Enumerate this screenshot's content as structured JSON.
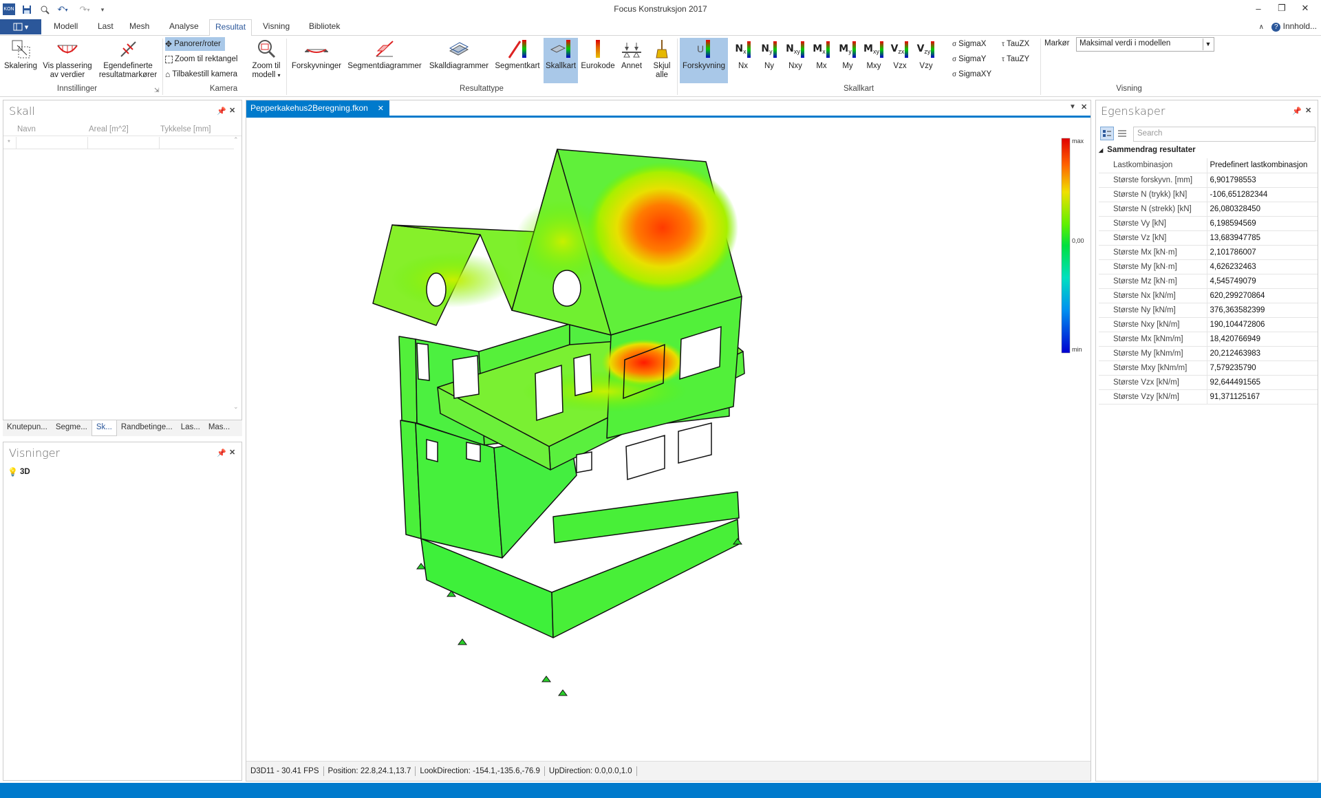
{
  "app": {
    "title": "Focus Konstruksjon 2017",
    "help_label": "Innhold..."
  },
  "ribbon_tabs": [
    {
      "label": "Modell",
      "active": false
    },
    {
      "label": "Last",
      "active": false
    },
    {
      "label": "Mesh",
      "active": false
    },
    {
      "label": "Analyse",
      "active": false
    },
    {
      "label": "Resultat",
      "active": true
    },
    {
      "label": "Visning",
      "active": false
    },
    {
      "label": "Bibliotek",
      "active": false
    }
  ],
  "ribbon": {
    "innstillinger": {
      "group_label": "Innstillinger",
      "skalering": "Skalering",
      "vis_plassering_1": "Vis plassering",
      "vis_plassering_2": "av verdier",
      "egendefinerte_1": "Egendefinerte",
      "egendefinerte_2": "resultatmarkører"
    },
    "kamera": {
      "group_label": "Kamera",
      "panorer": "Panorer/roter",
      "zoom_rektangel": "Zoom til rektangel",
      "tilbakestill": "Tilbakestill kamera",
      "zoom_modell_1": "Zoom til",
      "zoom_modell_2": "modell"
    },
    "resultattype": {
      "group_label": "Resultattype",
      "forskyvninger": "Forskyvninger",
      "segmentdiagrammer": "Segmentdiagrammer",
      "skalldiagrammer": "Skalldiagrammer",
      "segmentkart": "Segmentkart",
      "skallkart": "Skallkart",
      "eurokode": "Eurokode",
      "annet": "Annet",
      "skjul_1": "Skjul",
      "skjul_2": "alle"
    },
    "skallkart": {
      "group_label": "Skallkart",
      "forskyvning": "Forskyvning",
      "forskyvning_icon_letter": "U",
      "buttons": [
        {
          "main": "N",
          "sub": "x",
          "label": "Nx"
        },
        {
          "main": "N",
          "sub": "y",
          "label": "Ny"
        },
        {
          "main": "N",
          "sub": "xy",
          "label": "Nxy"
        },
        {
          "main": "M",
          "sub": "x",
          "label": "Mx"
        },
        {
          "main": "M",
          "sub": "y",
          "label": "My"
        },
        {
          "main": "M",
          "sub": "xy",
          "label": "Mxy"
        },
        {
          "main": "V",
          "sub": "zx",
          "label": "Vzx"
        },
        {
          "main": "V",
          "sub": "zy",
          "label": "Vzy"
        }
      ],
      "sigma_x": "SigmaX",
      "sigma_y": "SigmaY",
      "sigma_xy": "SigmaXY",
      "tau_zx": "TauZX",
      "tau_zy": "TauZY"
    },
    "visning": {
      "group_label": "Visning",
      "marker_label": "Markør",
      "marker_value": "Maksimal verdi i modellen"
    }
  },
  "skall_panel": {
    "title": "Skall",
    "columns": [
      "Navn",
      "Areal [m^2]",
      "Tykkelse [mm]"
    ],
    "new_row_marker": "*",
    "tabs": [
      "Knutepun...",
      "Segme...",
      "Sk...",
      "Randbetinge...",
      "Las...",
      "Mas..."
    ],
    "active_tab": 2
  },
  "visninger_panel": {
    "title": "Visninger",
    "item": "3D"
  },
  "document": {
    "tab_label": "Pepperkakehus2Beregning.fkon"
  },
  "legend": {
    "max": "max",
    "mid": "0,00",
    "min": "min"
  },
  "status": {
    "fps": "D3D11 - 30.41 FPS",
    "position": "Position: 22.8,24.1,13.7",
    "look": "LookDirection: -154.1,-135.6,-76.9",
    "up": "UpDirection: 0.0,0.0,1.0"
  },
  "properties": {
    "title": "Egenskaper",
    "search_placeholder": "Search",
    "category": "Sammendrag resultater",
    "rows": [
      {
        "k": "Lastkombinasjon",
        "v": "Predefinert lastkombinasjon"
      },
      {
        "k": "Største forskyvn. [mm]",
        "v": "6,901798553"
      },
      {
        "k": "Største N (trykk) [kN]",
        "v": "-106,651282344"
      },
      {
        "k": "Største N (strekk) [kN]",
        "v": "26,080328450"
      },
      {
        "k": "Største Vy [kN]",
        "v": "6,198594569"
      },
      {
        "k": "Største Vz [kN]",
        "v": "13,683947785"
      },
      {
        "k": "Største Mx [kN·m]",
        "v": "2,101786007"
      },
      {
        "k": "Største My [kN·m]",
        "v": "4,626232463"
      },
      {
        "k": "Største Mz [kN·m]",
        "v": "4,545749079"
      },
      {
        "k": "Største Nx [kN/m]",
        "v": "620,299270864"
      },
      {
        "k": "Største Ny [kN/m]",
        "v": "376,363582399"
      },
      {
        "k": "Største Nxy [kN/m]",
        "v": "190,104472806"
      },
      {
        "k": "Største Mx [kNm/m]",
        "v": "18,420766949"
      },
      {
        "k": "Største My [kNm/m]",
        "v": "20,212463983"
      },
      {
        "k": "Største Mxy [kNm/m]",
        "v": "7,579235790"
      },
      {
        "k": "Største Vzx [kN/m]",
        "v": "92,644491565"
      },
      {
        "k": "Største Vzy [kN/m]",
        "v": "91,371125167"
      }
    ]
  }
}
